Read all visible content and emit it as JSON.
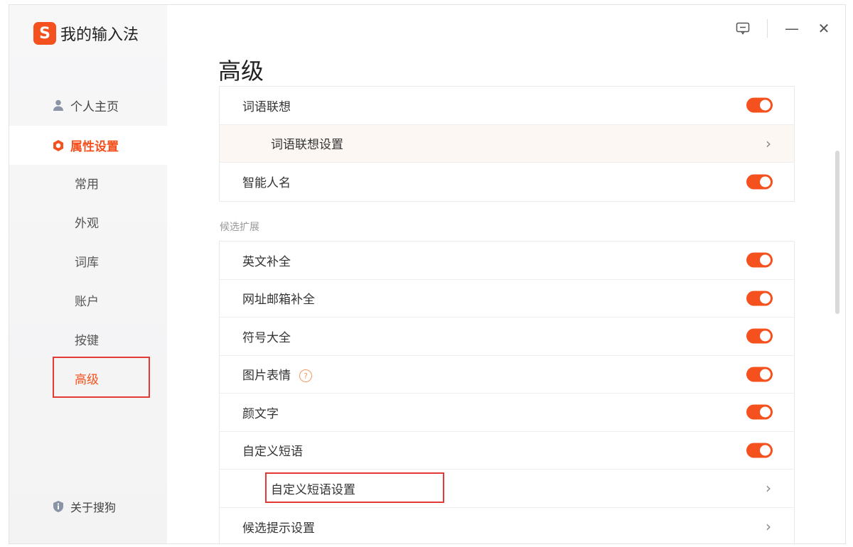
{
  "app": {
    "logo_letter": "S",
    "title": "我的输入法"
  },
  "sidebar": {
    "items": [
      {
        "label": "个人主页",
        "icon": "user-icon"
      },
      {
        "label": "属性设置",
        "icon": "gear-icon"
      },
      {
        "label": "常用"
      },
      {
        "label": "外观"
      },
      {
        "label": "词库"
      },
      {
        "label": "账户"
      },
      {
        "label": "按键"
      },
      {
        "label": "高级"
      }
    ],
    "about_label": "关于搜狗"
  },
  "page": {
    "title": "高级"
  },
  "group1": {
    "rows": [
      {
        "label": "词语联想",
        "control": "toggle",
        "on": true
      },
      {
        "label": "词语联想设置",
        "control": "chevron"
      },
      {
        "label": "智能人名",
        "control": "toggle",
        "on": true
      }
    ]
  },
  "group2": {
    "label": "候选扩展",
    "rows": [
      {
        "label": "英文补全",
        "control": "toggle",
        "on": true
      },
      {
        "label": "网址邮箱补全",
        "control": "toggle",
        "on": true
      },
      {
        "label": "符号大全",
        "control": "toggle",
        "on": true
      },
      {
        "label": "图片表情",
        "badge": "?",
        "control": "toggle",
        "on": true
      },
      {
        "label": "颜文字",
        "control": "toggle",
        "on": true
      },
      {
        "label": "自定义短语",
        "control": "toggle",
        "on": true
      },
      {
        "label": "自定义短语设置",
        "control": "chevron"
      },
      {
        "label": "候选提示设置",
        "control": "chevron"
      }
    ]
  },
  "colors": {
    "accent": "#f4511e",
    "highlight_border": "#e53935"
  },
  "glyphs": {
    "chevron": "›",
    "minimize": "—",
    "close": "✕"
  }
}
